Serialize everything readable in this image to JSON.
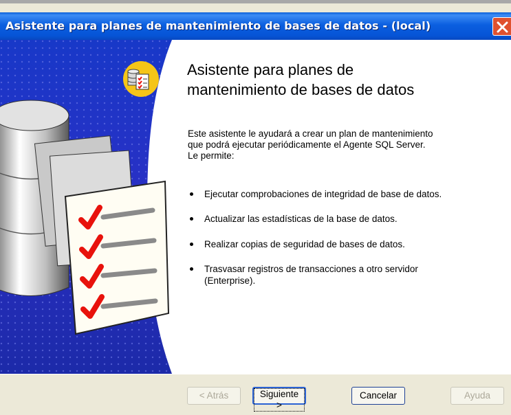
{
  "window": {
    "title": "Asistente para planes de mantenimiento de bases de datos - (local)"
  },
  "wizard": {
    "heading_line1": "Asistente para planes de",
    "heading_line2": "mantenimiento de bases de datos",
    "intro_line1": "Este asistente le ayudará a crear un plan de mantenimiento",
    "intro_line2": "que podrá ejecutar periódicamente el Agente SQL Server.",
    "intro_line3": "Le permite:",
    "bullets": [
      {
        "line1": "Ejecutar comprobaciones de integridad de base de datos.",
        "line2": ""
      },
      {
        "line1": "Actualizar las estadísticas de la base de datos.",
        "line2": ""
      },
      {
        "line1": "Realizar copias de seguridad de bases de datos.",
        "line2": ""
      },
      {
        "line1": "Trasvasar registros de transacciones a otro servidor",
        "line2": "(Enterprise)."
      }
    ]
  },
  "buttons": {
    "back": {
      "label": "< Atrás",
      "enabled": false
    },
    "next": {
      "label": "Siguiente >",
      "enabled": true
    },
    "cancel": {
      "label": "Cancelar",
      "enabled": true
    },
    "help": {
      "label": "Ayuda",
      "enabled": false
    }
  },
  "icons": {
    "close": "close-icon",
    "wizard": "database-checklist-icon",
    "side": "database-checklist-illustration"
  },
  "colors": {
    "titlebar": "#0b5fe0",
    "side_panel": "#2a2fc4",
    "close_button": "#e0512f",
    "icon_badge": "#f5c518",
    "check": "#e8120c"
  }
}
